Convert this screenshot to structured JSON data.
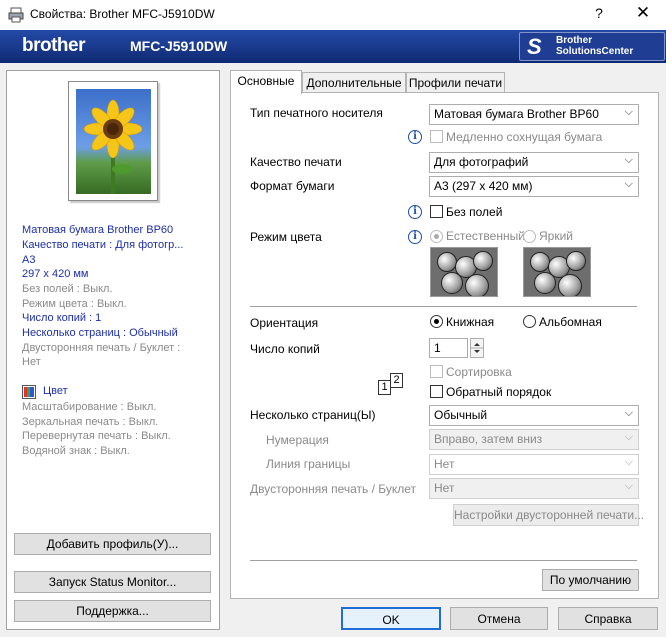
{
  "window": {
    "title": "Свойства: Brother MFC-J5910DW",
    "help_glyph": "?",
    "close_glyph": "✕"
  },
  "banner": {
    "logo": "brother",
    "model": "MFC-J5910DW",
    "solutions_line1": "Brother",
    "solutions_line2": "SolutionsCenter"
  },
  "summary": {
    "lines": [
      "Матовая бумага Brother BP60",
      "Качество печати : Для фотогр...",
      "A3",
      "297 x 420 мм",
      "Без полей : Выкл.",
      "Режим цвета : Выкл.",
      "Число копий : 1",
      "Несколько страниц : Обычный",
      "Двусторонняя печать / Буклет :",
      "Нет"
    ],
    "color_label": "Цвет",
    "lines2": [
      "Масштабирование : Выкл.",
      "Зеркальная печать : Выкл.",
      "Перевернутая печать : Выкл.",
      "Водяной знак : Выкл."
    ]
  },
  "left_buttons": {
    "add_profile": "Добавить профиль(У)...",
    "status_monitor": "Запуск Status Monitor...",
    "support": "Поддержка..."
  },
  "tabs": [
    "Основные",
    "Дополнительные",
    "Профили печати"
  ],
  "basic": {
    "media_type_label": "Тип печатного носителя",
    "media_type_value": "Матовая бумага Brother BP60",
    "slow_drying_label": "Медленно сохнущая бумага",
    "quality_label": "Качество печати",
    "quality_value": "Для фотографий",
    "paper_size_label": "Формат бумаги",
    "paper_size_value": "A3 (297 x 420 мм)",
    "borderless_label": "Без полей",
    "color_mode_label": "Режим цвета",
    "color_natural": "Естественный",
    "color_vivid": "Яркий",
    "orientation_label": "Ориентация",
    "portrait": "Книжная",
    "landscape": "Альбомная",
    "copies_label": "Число копий",
    "copies_value": "1",
    "collate_label": "Сортировка",
    "reverse_label": "Обратный порядок",
    "multipage_label": "Несколько страниц(Ы)",
    "multipage_value": "Обычный",
    "page_order_label": "Нумерация",
    "page_order_value": "Вправо, затем вниз",
    "border_line_label": "Линия границы",
    "border_line_value": "Нет",
    "duplex_label": "Двусторонняя печать / Буклет",
    "duplex_value": "Нет",
    "duplex_settings_button": "Настройки двусторонней печати...",
    "default_button": "По умолчанию",
    "copies_icon_1": "1",
    "copies_icon_2": "2"
  },
  "footer": {
    "ok": "OK",
    "cancel": "Отмена",
    "help": "Справка"
  },
  "colors": {
    "banner_blue": "#1b3a8c",
    "summary_blue": "#1d2fa8",
    "default_button_border": "#1e6ed6"
  }
}
